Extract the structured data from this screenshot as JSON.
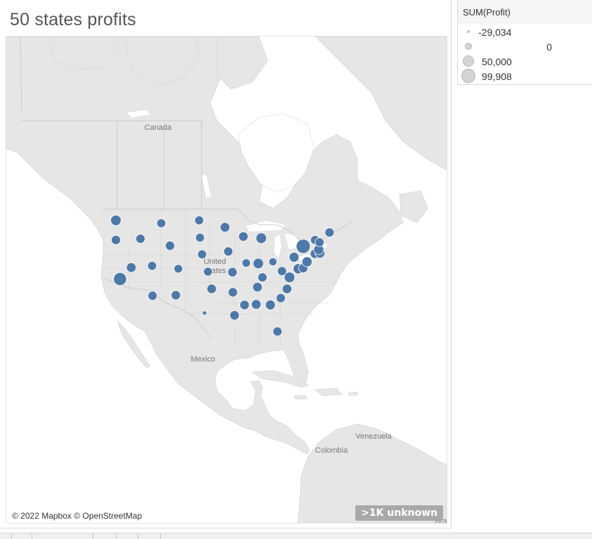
{
  "worksheet": {
    "title": "50 states profits"
  },
  "map": {
    "labels": {
      "canada": "Canada",
      "united_states_line1": "United",
      "united_states_line2": "States",
      "mexico": "Mexico",
      "venezuela": "Venezuela",
      "colombia": "Colombia",
      "brazil_partial": "Bra"
    },
    "attribution": "© 2022 Mapbox © OpenStreetMap",
    "unknown_indicator": ">1K unknown",
    "mark_color": "#4e79a7",
    "land_color": "#e6e6e6",
    "water_color": "#ffffff"
  },
  "legend": {
    "title": "SUM(Profit)",
    "items": [
      {
        "label": "-29,034",
        "value": -29034
      },
      {
        "label": "0",
        "value": 0
      },
      {
        "label": "50,000",
        "value": 50000
      },
      {
        "label": "99,908",
        "value": 99908
      }
    ]
  },
  "chart_data": {
    "type": "scatter",
    "title": "50 states profits",
    "size_field": "SUM(Profit)",
    "size_range": [
      -29034,
      99908
    ],
    "points": [
      {
        "lon": -120.5,
        "lat": 47.4,
        "profit": 33000
      },
      {
        "lon": -120.5,
        "lat": 44.0,
        "profit": 17500
      },
      {
        "lon": -119.5,
        "lat": 37.2,
        "profit": 76400
      },
      {
        "lon": -114.6,
        "lat": 44.2,
        "profit": 15000
      },
      {
        "lon": -116.8,
        "lat": 39.2,
        "profit": 21000
      },
      {
        "lon": -111.8,
        "lat": 39.5,
        "profit": 12000
      },
      {
        "lon": -111.7,
        "lat": 34.3,
        "profit": 15000
      },
      {
        "lon": -109.6,
        "lat": 46.9,
        "profit": 12000
      },
      {
        "lon": -107.5,
        "lat": 43.0,
        "profit": 17000
      },
      {
        "lon": -105.5,
        "lat": 39.0,
        "profit": 8000
      },
      {
        "lon": -106.1,
        "lat": 34.4,
        "profit": 18000
      },
      {
        "lon": -100.5,
        "lat": 47.4,
        "profit": 12000
      },
      {
        "lon": -100.3,
        "lat": 44.4,
        "profit": 10000
      },
      {
        "lon": -99.8,
        "lat": 41.5,
        "profit": 12000
      },
      {
        "lon": -98.4,
        "lat": 38.5,
        "profit": 11000
      },
      {
        "lon": -97.5,
        "lat": 35.5,
        "profit": 20000
      },
      {
        "lon": -99.2,
        "lat": 31.3,
        "profit": -25000
      },
      {
        "lon": -94.3,
        "lat": 46.2,
        "profit": 22000
      },
      {
        "lon": -93.5,
        "lat": 42.0,
        "profit": 15000
      },
      {
        "lon": -92.5,
        "lat": 38.4,
        "profit": 19000
      },
      {
        "lon": -92.4,
        "lat": 34.9,
        "profit": 18000
      },
      {
        "lon": -92.0,
        "lat": 30.9,
        "profit": 19000
      },
      {
        "lon": -89.9,
        "lat": 44.6,
        "profit": 20000
      },
      {
        "lon": -89.2,
        "lat": 40.0,
        "profit": 5000
      },
      {
        "lon": -89.6,
        "lat": 32.7,
        "profit": 20000
      },
      {
        "lon": -86.8,
        "lat": 32.8,
        "profit": 21000
      },
      {
        "lon": -86.5,
        "lat": 35.8,
        "profit": 22000
      },
      {
        "lon": -85.6,
        "lat": 44.3,
        "profit": 35000
      },
      {
        "lon": -86.3,
        "lat": 39.9,
        "profit": 33000
      },
      {
        "lon": -85.3,
        "lat": 37.5,
        "profit": 16000
      },
      {
        "lon": -82.8,
        "lat": 40.2,
        "profit": 2000
      },
      {
        "lon": -80.6,
        "lat": 38.6,
        "profit": 14000
      },
      {
        "lon": -83.4,
        "lat": 32.7,
        "profit": 25000
      },
      {
        "lon": -81.7,
        "lat": 28.1,
        "profit": 15000
      },
      {
        "lon": -80.9,
        "lat": 33.9,
        "profit": 15000
      },
      {
        "lon": -79.4,
        "lat": 35.5,
        "profit": 22000
      },
      {
        "lon": -78.8,
        "lat": 37.5,
        "profit": 36000
      },
      {
        "lon": -77.7,
        "lat": 41.0,
        "profit": 25000
      },
      {
        "lon": -75.5,
        "lat": 42.9,
        "profit": 99908
      },
      {
        "lon": -76.7,
        "lat": 39.0,
        "profit": 28000
      },
      {
        "lon": -75.5,
        "lat": 39.1,
        "profit": 17000
      },
      {
        "lon": -74.6,
        "lat": 40.2,
        "profit": 29000
      },
      {
        "lon": -72.7,
        "lat": 41.6,
        "profit": 20000
      },
      {
        "lon": -71.5,
        "lat": 41.7,
        "profit": 24000
      },
      {
        "lon": -71.8,
        "lat": 42.3,
        "profit": 26000
      },
      {
        "lon": -72.7,
        "lat": 44.0,
        "profit": 12000
      },
      {
        "lon": -71.6,
        "lat": 43.6,
        "profit": 13000
      },
      {
        "lon": -69.2,
        "lat": 45.3,
        "profit": 15000
      }
    ]
  }
}
